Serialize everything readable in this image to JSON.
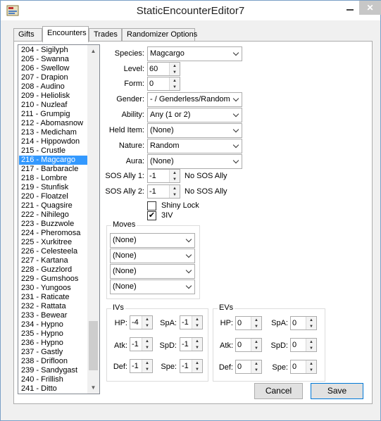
{
  "window": {
    "title": "StaticEncounterEditor7"
  },
  "tabs": [
    "Gifts",
    "Encounters",
    "Trades",
    "Randomizer Options"
  ],
  "list": {
    "items": [
      "204 - Sigilyph",
      "205 - Swanna",
      "206 - Swellow",
      "207 - Drapion",
      "208 - Audino",
      "209 - Heliolisk",
      "210 - Nuzleaf",
      "211 - Grumpig",
      "212 - Abomasnow",
      "213 - Medicham",
      "214 - Hippowdon",
      "215 - Crustle",
      "216 - Magcargo",
      "217 - Barbaracle",
      "218 - Lombre",
      "219 - Stunfisk",
      "220 - Floatzel",
      "221 - Quagsire",
      "222 - Nihilego",
      "223 - Buzzwole",
      "224 - Pheromosa",
      "225 - Xurkitree",
      "226 - Celesteela",
      "227 - Kartana",
      "228 - Guzzlord",
      "229 - Gumshoos",
      "230 - Yungoos",
      "231 - Raticate",
      "232 - Rattata",
      "233 - Bewear",
      "234 - Hypno",
      "235 - Hypno",
      "236 - Hypno",
      "237 - Gastly",
      "238 - Drifloon",
      "239 - Sandygast",
      "240 - Frillish",
      "241 - Ditto"
    ]
  },
  "form": {
    "species_label": "Species:",
    "species": "Magcargo",
    "level_label": "Level:",
    "level": "60",
    "form_label": "Form:",
    "form": "0",
    "gender_label": "Gender:",
    "gender": "- / Genderless/Random",
    "ability_label": "Ability:",
    "ability": "Any (1 or 2)",
    "helditem_label": "Held Item:",
    "helditem": "(None)",
    "nature_label": "Nature:",
    "nature": "Random",
    "aura_label": "Aura:",
    "aura": "(None)",
    "sos1_label": "SOS Ally 1:",
    "sos1": "-1",
    "sos1_desc": "No SOS Ally",
    "sos2_label": "SOS Ally 2:",
    "sos2": "-1",
    "sos2_desc": "No SOS Ally",
    "shinylock_label": "Shiny Lock",
    "iv3_label": "3IV"
  },
  "moves": {
    "title": "Moves",
    "values": [
      "(None)",
      "(None)",
      "(None)",
      "(None)"
    ]
  },
  "ivs": {
    "title": "IVs",
    "hp_label": "HP:",
    "hp": "-4",
    "atk_label": "Atk:",
    "atk": "-1",
    "def_label": "Def:",
    "def": "-1",
    "spa_label": "SpA:",
    "spa": "-1",
    "spd_label": "SpD:",
    "spd": "-1",
    "spe_label": "Spe:",
    "spe": "-1"
  },
  "evs": {
    "title": "EVs",
    "hp_label": "HP:",
    "hp": "0",
    "atk_label": "Atk:",
    "atk": "0",
    "def_label": "Def:",
    "def": "0",
    "spa_label": "SpA:",
    "spa": "0",
    "spd_label": "SpD:",
    "spd": "0",
    "spe_label": "Spe:",
    "spe": "0"
  },
  "buttons": {
    "cancel": "Cancel",
    "save": "Save"
  }
}
